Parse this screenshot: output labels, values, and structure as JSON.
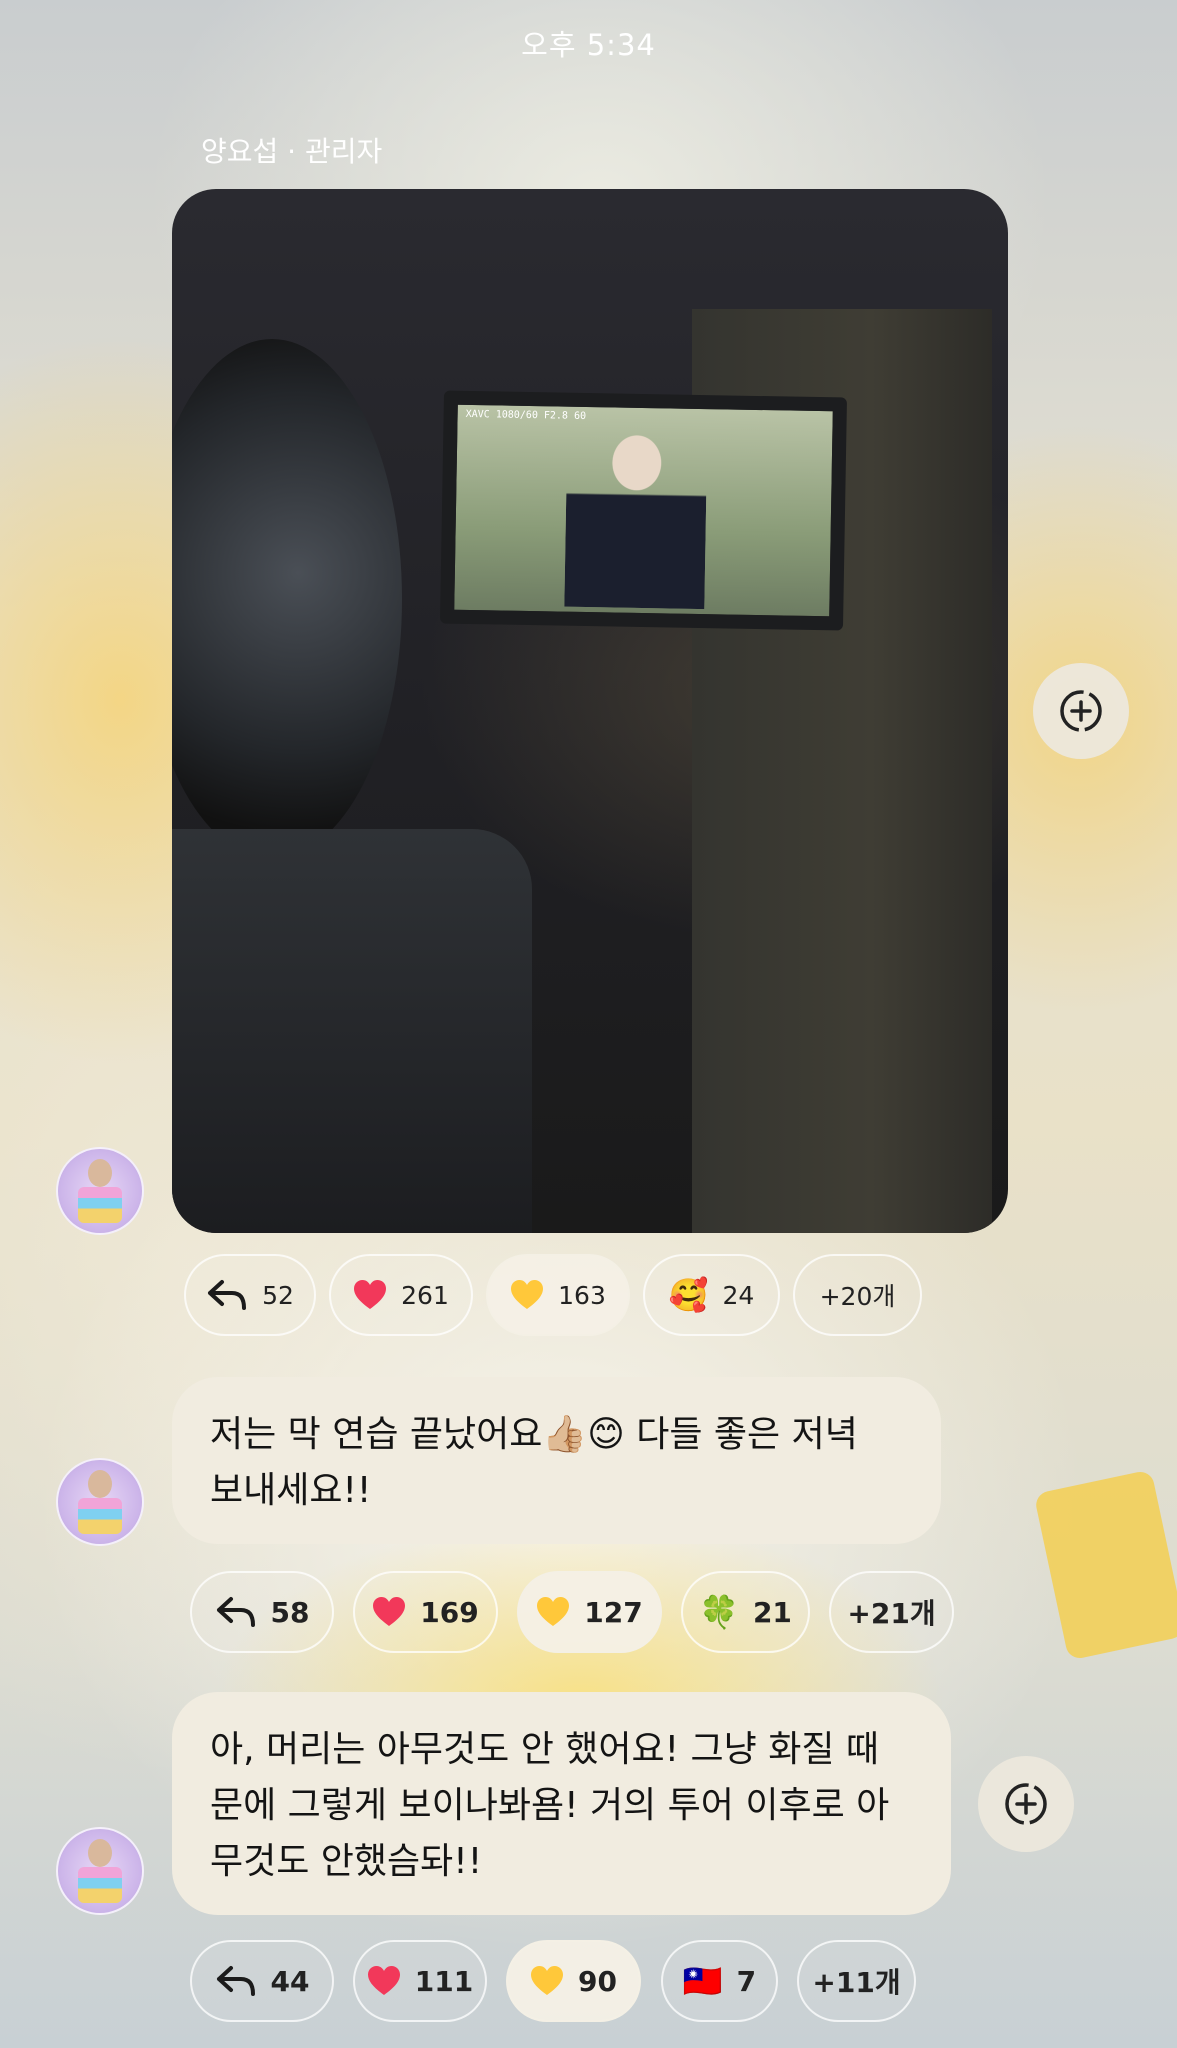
{
  "status_bar": {
    "time": "오후 5:34"
  },
  "sender": {
    "name": "양요섭 · 관리자"
  },
  "photo_message": {
    "camera_hud": "XAVC 1080/60  F2.8  60",
    "reactions": {
      "reply_count": "52",
      "items": [
        {
          "emoji": "red-heart",
          "count": "261"
        },
        {
          "emoji": "yellow-heart",
          "count": "163",
          "selected": true
        },
        {
          "emoji": "🥰",
          "count": "24"
        }
      ],
      "more": "+20개"
    }
  },
  "messages": [
    {
      "text": "저는 막 연습 끝났어요👍🏼😊 다들 좋은 저녁 보내세요!!",
      "reactions": {
        "reply_count": "58",
        "items": [
          {
            "emoji": "red-heart",
            "count": "169"
          },
          {
            "emoji": "yellow-heart",
            "count": "127",
            "selected": true
          },
          {
            "emoji": "🍀",
            "count": "21"
          }
        ],
        "more": "+21개"
      }
    },
    {
      "text": "아, 머리는 아무것도 안 했어요! 그냥 화질 때문에 그렇게 보이나봐욤! 거의 투어 이후로 아무것도 안했슴돠!!",
      "reactions": {
        "reply_count": "44",
        "items": [
          {
            "emoji": "red-heart",
            "count": "111"
          },
          {
            "emoji": "yellow-heart",
            "count": "90",
            "selected": true
          },
          {
            "emoji": "🇹🇼",
            "count": "7"
          }
        ],
        "more": "+11개"
      }
    }
  ],
  "colors": {
    "bubble": "#f1ece0",
    "red_heart": "#f2385a",
    "yellow_heart": "#ffc83a"
  }
}
